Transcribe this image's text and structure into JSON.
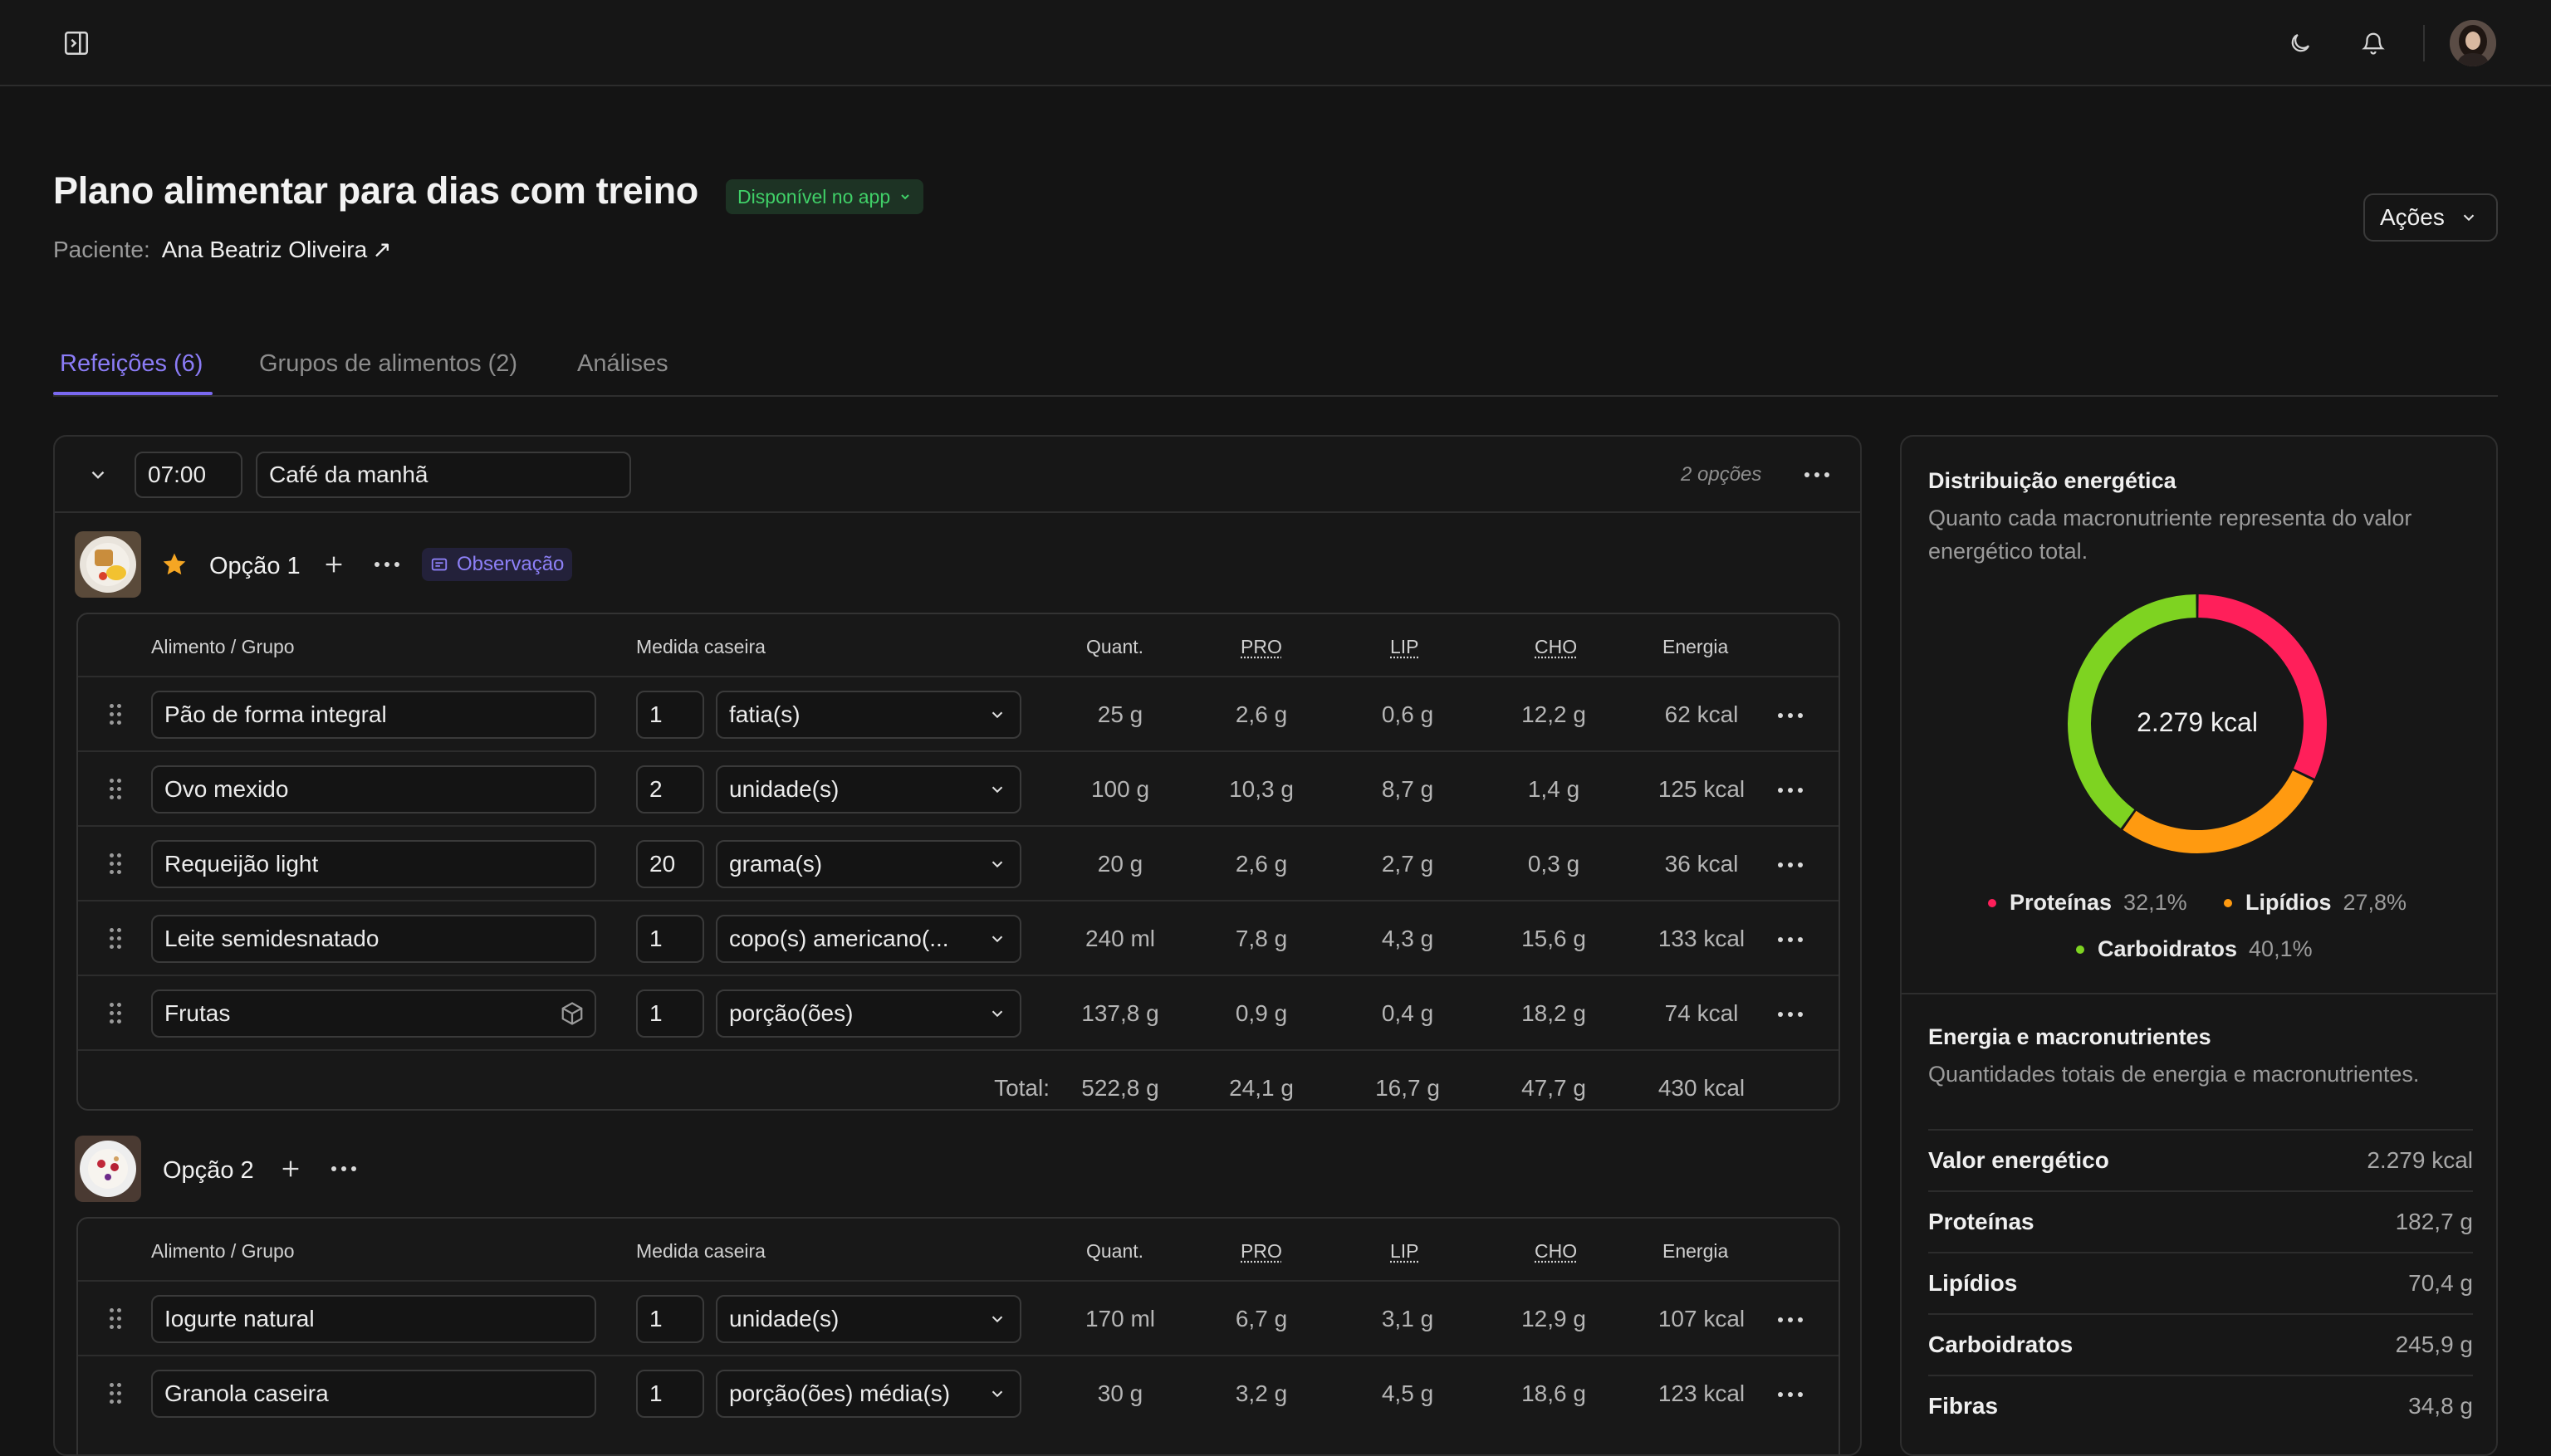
{
  "topbar": {
    "avatar_alt": "Foto do usuário"
  },
  "header": {
    "title": "Plano alimentar para dias com treino",
    "badge": "Disponível no app",
    "patient_label": "Paciente:",
    "patient_name": "Ana Beatriz Oliveira",
    "actions_label": "Ações"
  },
  "tabs": [
    {
      "label": "Refeições (6)",
      "active": true
    },
    {
      "label": "Grupos de alimentos (2)",
      "active": false
    },
    {
      "label": "Análises",
      "active": false
    }
  ],
  "meal": {
    "time": "07:00",
    "name": "Café da manhã",
    "options_count": "2 opções",
    "columns": {
      "food": "Alimento / Grupo",
      "measure": "Medida caseira",
      "quant": "Quant.",
      "pro": "PRO",
      "lip": "LIP",
      "cho": "CHO",
      "energy": "Energia"
    },
    "options": [
      {
        "label": "Opção 1",
        "favorite": true,
        "observation": "Observação",
        "rows": [
          {
            "food": "Pão de forma integral",
            "qty": "1",
            "unit": "fatia(s)",
            "quant": "25 g",
            "pro": "2,6 g",
            "lip": "0,6 g",
            "cho": "12,2 g",
            "energy": "62 kcal"
          },
          {
            "food": "Ovo mexido",
            "qty": "2",
            "unit": "unidade(s)",
            "quant": "100 g",
            "pro": "10,3 g",
            "lip": "8,7 g",
            "cho": "1,4 g",
            "energy": "125 kcal"
          },
          {
            "food": "Requeijão light",
            "qty": "20",
            "unit": "grama(s)",
            "quant": "20 g",
            "pro": "2,6 g",
            "lip": "2,7 g",
            "cho": "0,3 g",
            "energy": "36 kcal"
          },
          {
            "food": "Leite semidesnatado",
            "qty": "1",
            "unit": "copo(s) americano(...",
            "quant": "240 ml",
            "pro": "7,8 g",
            "lip": "4,3 g",
            "cho": "15,6 g",
            "energy": "133 kcal"
          },
          {
            "food": "Frutas",
            "qty": "1",
            "unit": "porção(ões)",
            "quant": "137,8 g",
            "pro": "0,9 g",
            "lip": "0,4 g",
            "cho": "18,2 g",
            "energy": "74 kcal",
            "group": true
          }
        ],
        "total": {
          "label": "Total:",
          "quant": "522,8 g",
          "pro": "24,1 g",
          "lip": "16,7 g",
          "cho": "47,7 g",
          "energy": "430 kcal"
        }
      },
      {
        "label": "Opção 2",
        "favorite": false,
        "rows": [
          {
            "food": "Iogurte natural",
            "qty": "1",
            "unit": "unidade(s)",
            "quant": "170 ml",
            "pro": "6,7 g",
            "lip": "3,1 g",
            "cho": "12,9 g",
            "energy": "107 kcal"
          },
          {
            "food": "Granola caseira",
            "qty": "1",
            "unit": "porção(ões) média(s)",
            "quant": "30 g",
            "pro": "3,2 g",
            "lip": "4,5 g",
            "cho": "18,6 g",
            "energy": "123 kcal"
          }
        ]
      }
    ]
  },
  "distribution": {
    "title": "Distribuição energética",
    "subtitle": "Quanto cada macronutriente representa do valor energético total.",
    "total": "2.279 kcal",
    "segments": [
      {
        "name": "Proteínas",
        "value": "32,1%",
        "pct": 32.1,
        "color": "#ff1f5a"
      },
      {
        "name": "Lipídios",
        "value": "27,8%",
        "pct": 27.8,
        "color": "#ff9a10"
      },
      {
        "name": "Carboidratos",
        "value": "40,1%",
        "pct": 40.1,
        "color": "#7ed321"
      }
    ]
  },
  "macros": {
    "title": "Energia e macronutrientes",
    "subtitle": "Quantidades totais de energia e macronutrientes.",
    "rows": [
      {
        "label": "Valor energético",
        "value": "2.279 kcal"
      },
      {
        "label": "Proteínas",
        "value": "182,7 g"
      },
      {
        "label": "Lipídios",
        "value": "70,4 g"
      },
      {
        "label": "Carboidratos",
        "value": "245,9 g"
      },
      {
        "label": "Fibras",
        "value": "34,8 g"
      }
    ]
  }
}
